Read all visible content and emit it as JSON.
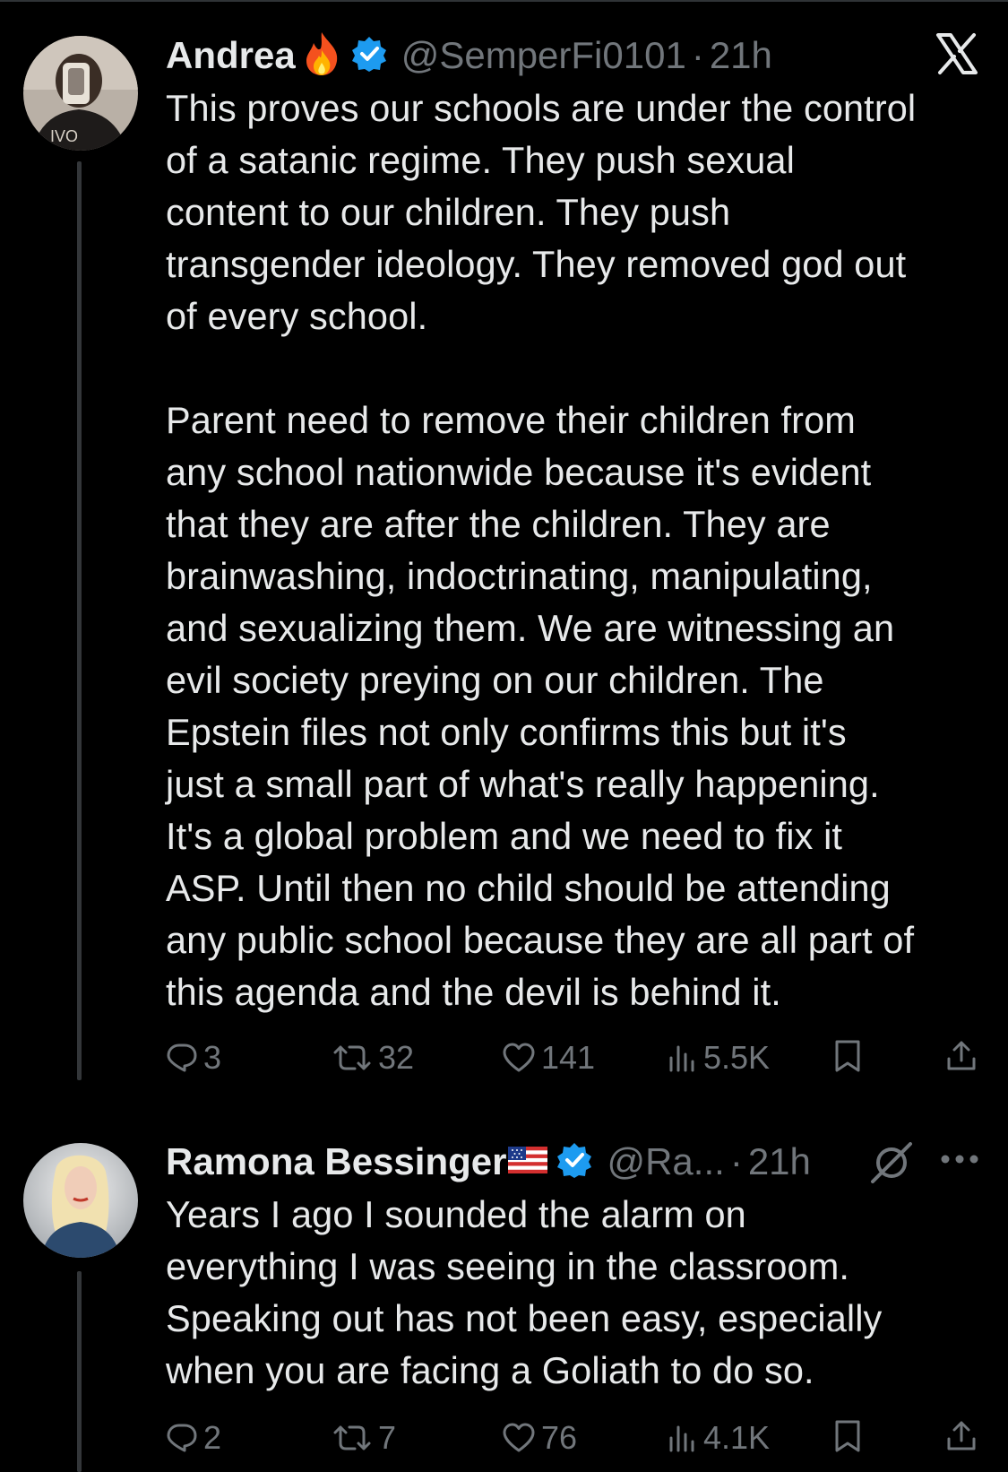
{
  "tweets": [
    {
      "name": "Andrea",
      "handle": "@SemperFi0101",
      "separator": "·",
      "time": "21h",
      "avatar_text": "IVO",
      "body": "This proves our schools are under the control\nof a satanic regime. They push sexual\ncontent to our children. They push\ntransgender ideology. They removed god out\nof every school.\n\nParent need to remove their children from\nany school nationwide because it's evident\nthat they are after the children. They are\nbrainwashing, indoctrinating, manipulating,\nand sexualizing them. We are witnessing an\nevil society preying on our children. The\nEpstein files not only confirms this but it's\njust a small part of what's really happening.\nIt's a global problem and we need to fix it\nASP. Until then no child should be attending\nany public school because they are all part of\nthis agenda and the devil is behind it.",
      "replies": "3",
      "reposts": "32",
      "likes": "141",
      "views": "5.5K"
    },
    {
      "name": "Ramona Bessinger",
      "handle": "@Ra...",
      "separator": "·",
      "time": "21h",
      "body": "Years I ago I sounded the alarm on\neverything I was seeing in the classroom.\nSpeaking out has not been easy, especially\nwhen you are facing a Goliath to do so.",
      "replies": "2",
      "reposts": "7",
      "likes": "76",
      "views": "4.1K"
    }
  ],
  "colors": {
    "background": "#000000",
    "text": "#e7e9ea",
    "muted": "#71767b",
    "verified": "#1d9bf0",
    "thread_line": "#333639"
  },
  "icons": [
    "x-logo-icon",
    "verified-badge-icon",
    "flame-emoji-icon",
    "us-flag-emoji-icon",
    "reply-icon",
    "repost-icon",
    "like-icon",
    "views-icon",
    "bookmark-icon",
    "share-icon",
    "grok-icon",
    "more-icon"
  ]
}
